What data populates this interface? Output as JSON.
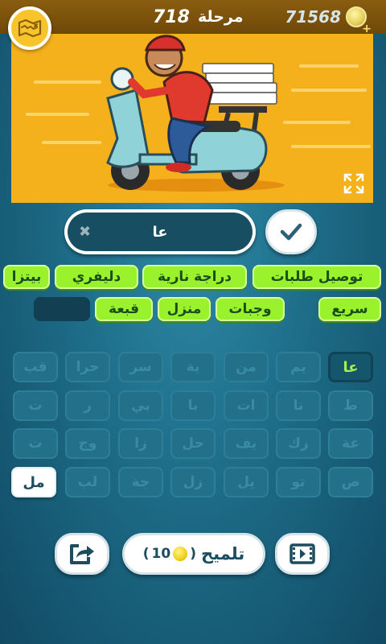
{
  "header": {
    "level_label": "مرحلة",
    "level_number": "718",
    "coins": "71568",
    "plus": "+"
  },
  "answer": {
    "text": "عا",
    "clear_symbol": "✖"
  },
  "word_chips": [
    "توصيل طلبات",
    "دراجة نارية",
    "دليفري",
    "بيتزا",
    "سريع",
    "وجبات",
    "منزل",
    "قبعة"
  ],
  "letter_tiles": [
    [
      "عا",
      "يم",
      "من",
      "ية",
      "سر",
      "حرا",
      "قب"
    ],
    [
      "ط",
      "نا",
      "ات",
      "با",
      "بي",
      "ر",
      "ت"
    ],
    [
      "عة",
      "رك",
      "يف",
      "حل",
      "زا",
      "وج",
      "ت"
    ],
    [
      "ص",
      "تو",
      "يل",
      "زل",
      "جة",
      "لب",
      "مل"
    ]
  ],
  "hint": {
    "label": "تلميح",
    "open_paren": "(",
    "cost": "10",
    "close_paren": ")"
  },
  "colors": {
    "chip_green": "#9af22c",
    "accent_yellow": "#f7c52b",
    "picture_bg": "#f5b11c"
  }
}
